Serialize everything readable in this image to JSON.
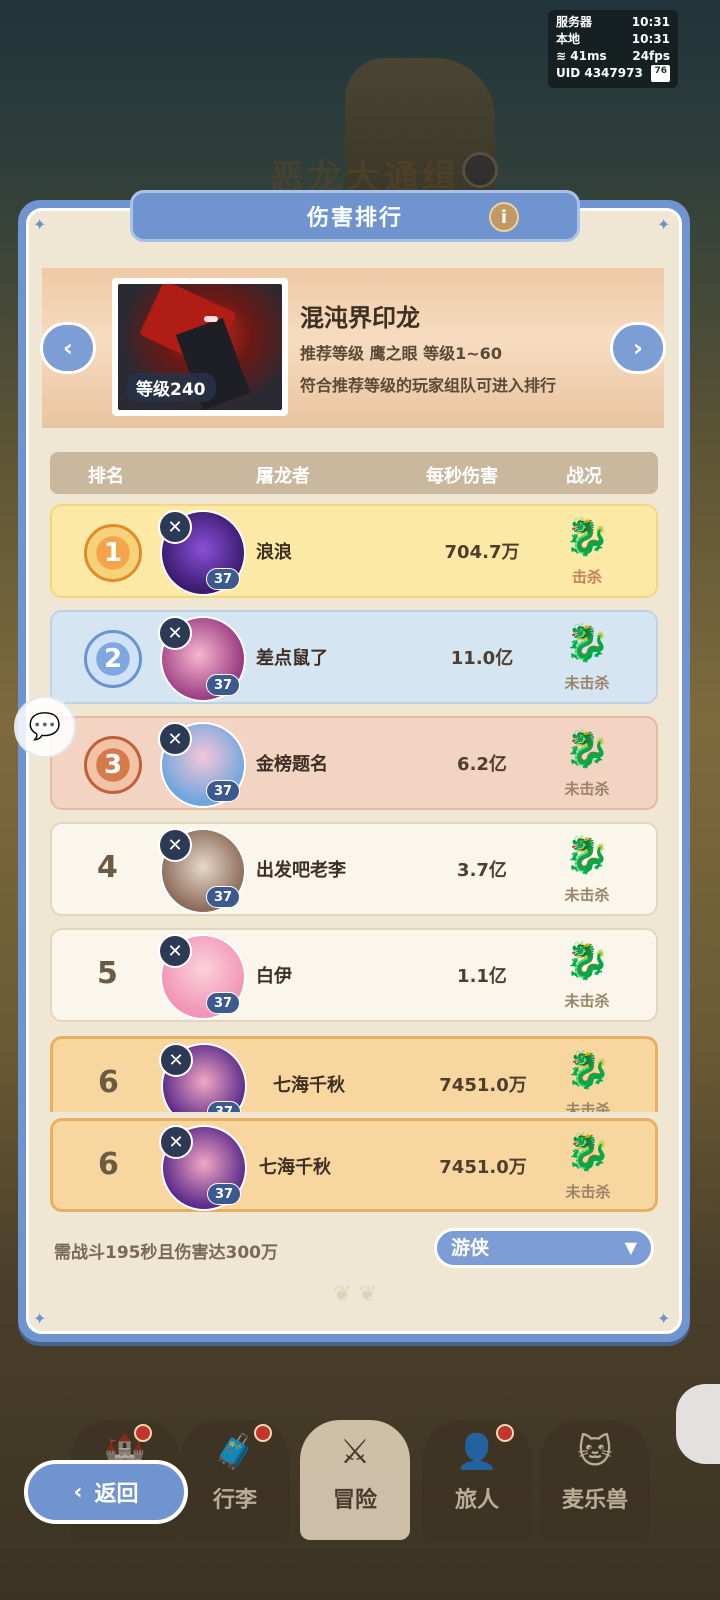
{
  "status": {
    "server_label": "服务器",
    "server_time": "10:31",
    "local_label": "本地",
    "local_time": "10:31",
    "ping": "41ms",
    "fps": "24fps",
    "uid": "UID 4347973",
    "battery": "76"
  },
  "background": {
    "title": "恶龙大通缉"
  },
  "panel": {
    "title": "伤害排行",
    "info_icon": "i"
  },
  "boss": {
    "name": "混沌界印龙",
    "level": "等级240",
    "recommend": "推荐等级  鹰之眼  等级1~60",
    "note": "符合推荐等级的玩家组队可进入排行"
  },
  "table": {
    "headers": {
      "rank": "排名",
      "slayer": "屠龙者",
      "dps": "每秒伤害",
      "status": "战况"
    },
    "rows": [
      {
        "rank": "1",
        "name": "浪浪",
        "dps": "704.7万",
        "level": "37",
        "status": "击杀"
      },
      {
        "rank": "2",
        "name": "差点鼠了",
        "dps": "11.0亿",
        "level": "37",
        "status": "未击杀"
      },
      {
        "rank": "3",
        "name": "金榜题名",
        "dps": "6.2亿",
        "level": "37",
        "status": "未击杀"
      },
      {
        "rank": "4",
        "name": "出发吧老李",
        "dps": "3.7亿",
        "level": "37",
        "status": "未击杀"
      },
      {
        "rank": "5",
        "name": "白伊",
        "dps": "1.1亿",
        "level": "37",
        "status": "未击杀"
      },
      {
        "rank": "6",
        "name": "七海千秋",
        "dps": "7451.0万",
        "level": "37",
        "status": "未击杀"
      }
    ],
    "self_row": {
      "rank": "6",
      "name": "七海千秋",
      "dps": "7451.0万",
      "level": "37",
      "status": "未击杀"
    }
  },
  "footer": {
    "requirement": "需战斗195秒且伤害达300万",
    "class_select": "游侠"
  },
  "nav": {
    "back": "返回",
    "items": [
      "行李",
      "冒险",
      "旅人",
      "麦乐兽"
    ]
  },
  "colors": {
    "accent": "#6f94cf",
    "gold": "#fde9a6",
    "silver": "#d6e5f2",
    "bronze": "#f3d3c2"
  }
}
